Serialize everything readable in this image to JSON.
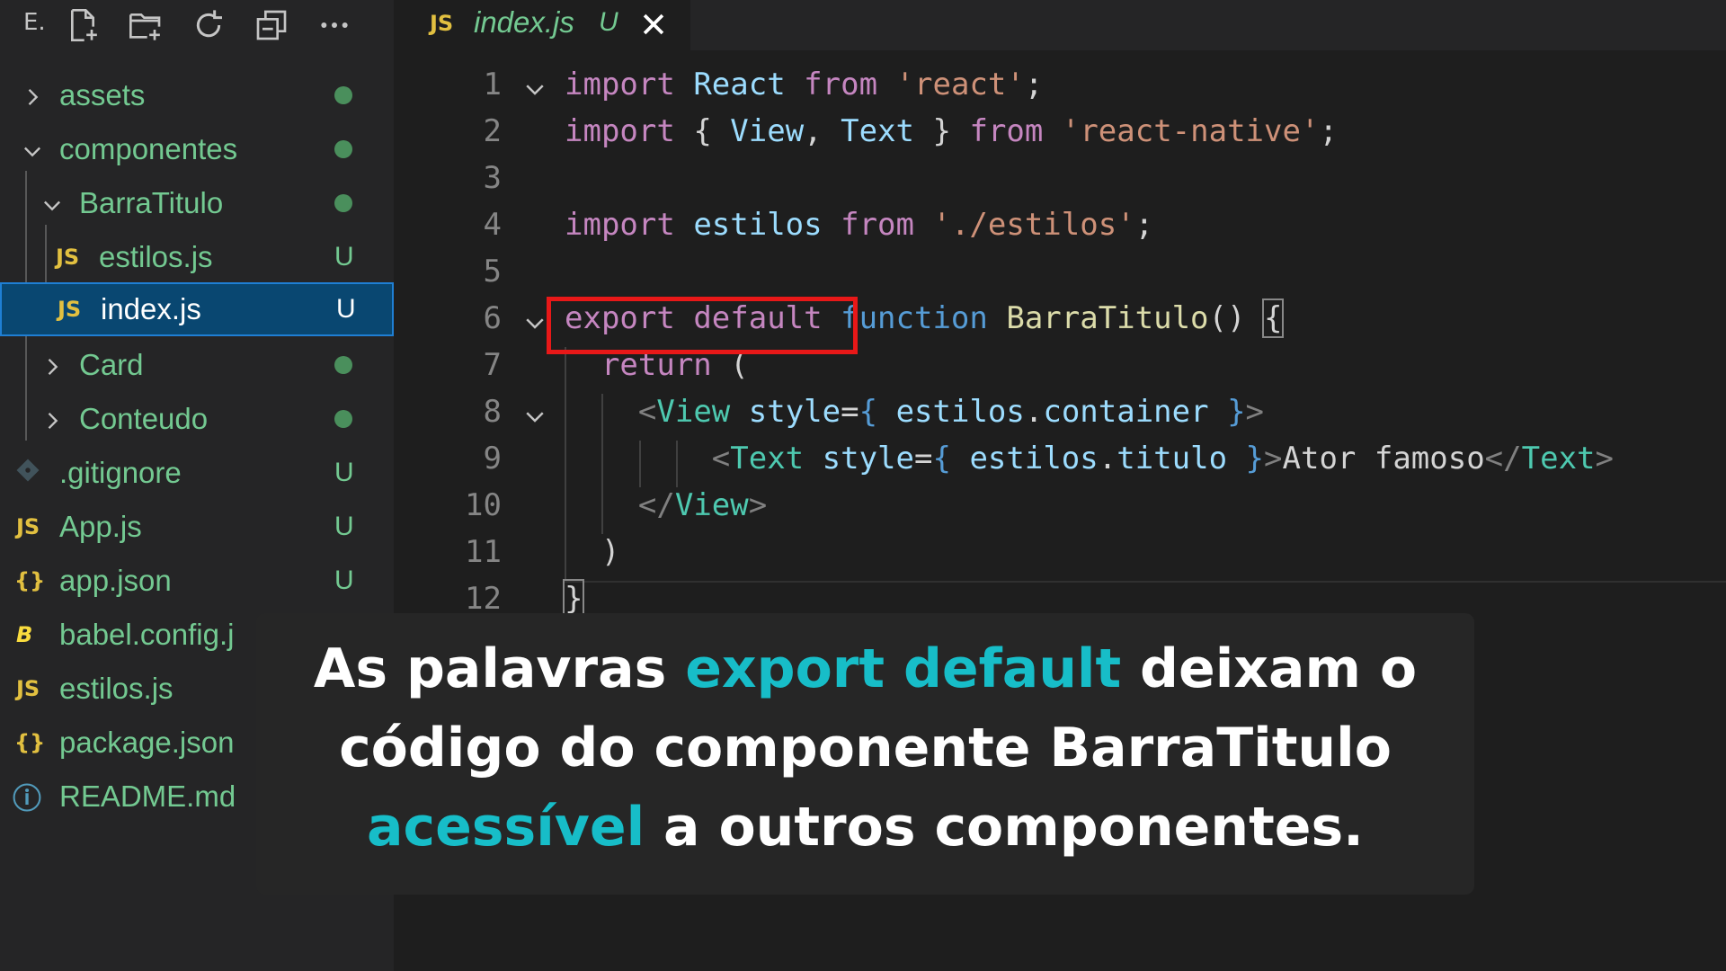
{
  "sidebar": {
    "explorer_label": "E.",
    "toolbar_icons": [
      "new-file-icon",
      "new-folder-icon",
      "refresh-icon",
      "collapse-all-icon",
      "more-icon"
    ],
    "items": [
      {
        "label": "assets",
        "type": "folder",
        "expanded": false,
        "status": "dot"
      },
      {
        "label": "componentes",
        "type": "folder",
        "expanded": true,
        "status": "dot"
      },
      {
        "label": "BarraTitulo",
        "type": "folder",
        "expanded": true,
        "status": "dot"
      },
      {
        "label": "estilos.js",
        "type": "file",
        "icon": "JS",
        "status": "U"
      },
      {
        "label": "index.js",
        "type": "file",
        "icon": "JS",
        "status": "U",
        "selected": true
      },
      {
        "label": "Card",
        "type": "folder",
        "expanded": false,
        "status": "dot"
      },
      {
        "label": "Conteudo",
        "type": "folder",
        "expanded": false,
        "status": "dot"
      },
      {
        "label": ".gitignore",
        "type": "file",
        "icon": "git-icon",
        "status": "U"
      },
      {
        "label": "App.js",
        "type": "file",
        "icon": "JS",
        "status": "U"
      },
      {
        "label": "app.json",
        "type": "file",
        "icon": "{}",
        "status": "U"
      },
      {
        "label": "babel.config.j",
        "type": "file",
        "icon": "B"
      },
      {
        "label": "estilos.js",
        "type": "file",
        "icon": "JS"
      },
      {
        "label": "package.json",
        "type": "file",
        "icon": "{}"
      },
      {
        "label": "README.md",
        "type": "file",
        "icon": "ⓘ"
      }
    ]
  },
  "tab": {
    "icon": "JS",
    "label": "index.js",
    "status": "U",
    "close": "✕"
  },
  "editor": {
    "line_numbers": [
      "1",
      "2",
      "3",
      "4",
      "5",
      "6",
      "7",
      "8",
      "9",
      "10",
      "11",
      "12"
    ],
    "lines": [
      "import React from 'react';",
      "import { View, Text } from 'react-native';",
      "",
      "import estilos from './estilos';",
      "",
      "export default function BarraTitulo() {",
      "  return (",
      "    <View style={ estilos.container }>",
      "        <Text style={ estilos.titulo }>Ator famoso</Text>",
      "    </View>",
      "  )",
      "}"
    ],
    "tokens": {
      "import": "import",
      "from": "from",
      "react": "React",
      "str_react": "'react'",
      "semi": ";",
      "lbrace": "{",
      "rbrace": "}",
      "view": "View",
      "comma": ",",
      "text": "Text",
      "str_rn": "'react-native'",
      "estilos": "estilos",
      "str_estilos": "'./estilos'",
      "export": "export",
      "default": "default",
      "function": "function",
      "barra": "BarraTitulo",
      "parens": "()",
      "return": "return",
      "lparen": "(",
      "rparen": ")",
      "lt": "<",
      "gt": ">",
      "lt_slash": "</",
      "style": "style",
      "eq": "=",
      "dot": ".",
      "container": "container",
      "titulo": "titulo",
      "ator": "Ator famoso"
    }
  },
  "caption": {
    "part1": "As palavras ",
    "accent1": "export default",
    "part2": " deixam o",
    "line2": "código do componente BarraTitulo",
    "accent2": "acessível",
    "part3": " a outros componentes."
  },
  "colors": {
    "accent": "#17bdc8",
    "highlight_box": "#e81818",
    "git_added": "#73c991"
  }
}
